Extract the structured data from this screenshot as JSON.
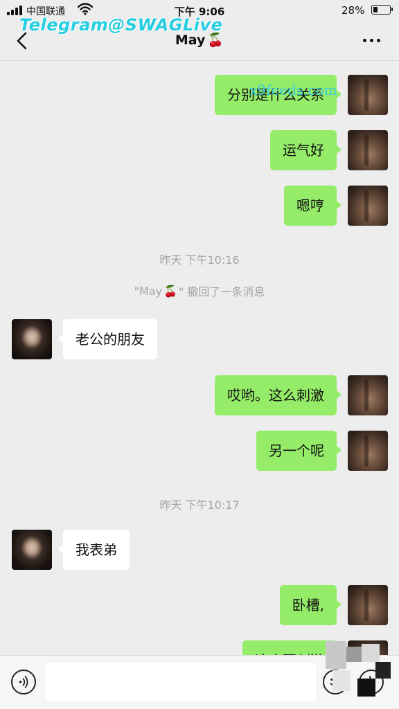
{
  "status_bar": {
    "carrier": "中国联通",
    "time": "下午 9:06",
    "battery_pct": "28%",
    "battery_level": 0.28
  },
  "watermark": {
    "text": "Telegram@SWAGLive",
    "overlay_text": "x9feeds.com"
  },
  "nav": {
    "title": "May",
    "title_emoji": "🍒"
  },
  "messages": [
    {
      "dir": "out",
      "text": "分别是什么关系"
    },
    {
      "dir": "out",
      "text": "运气好"
    },
    {
      "dir": "out",
      "text": "嗯哼"
    },
    {
      "dir": "time",
      "text": "昨天 下午10:16"
    },
    {
      "dir": "system",
      "name": "\"May",
      "emoji": "🍒",
      "text": "\" 撤回了一条消息"
    },
    {
      "dir": "in",
      "text": "老公的朋友"
    },
    {
      "dir": "out",
      "text": "哎哟。这么刺激"
    },
    {
      "dir": "out",
      "text": "另一个呢"
    },
    {
      "dir": "time",
      "text": "昨天 下午10:17"
    },
    {
      "dir": "in",
      "text": "我表弟"
    },
    {
      "dir": "out",
      "text": "卧槽,"
    },
    {
      "dir": "out",
      "text": "这个更刺激"
    }
  ],
  "input": {
    "placeholder": ""
  },
  "colors": {
    "outgoing_bubble": "#95ec69",
    "incoming_bubble": "#ffffff",
    "background": "#ededed",
    "watermark": "#25cde0"
  },
  "icons": {
    "back": "chevron-left-icon",
    "more": "ellipsis-icon",
    "voice": "voice-icon",
    "emoji": "emoji-icon",
    "plus": "plus-icon"
  }
}
